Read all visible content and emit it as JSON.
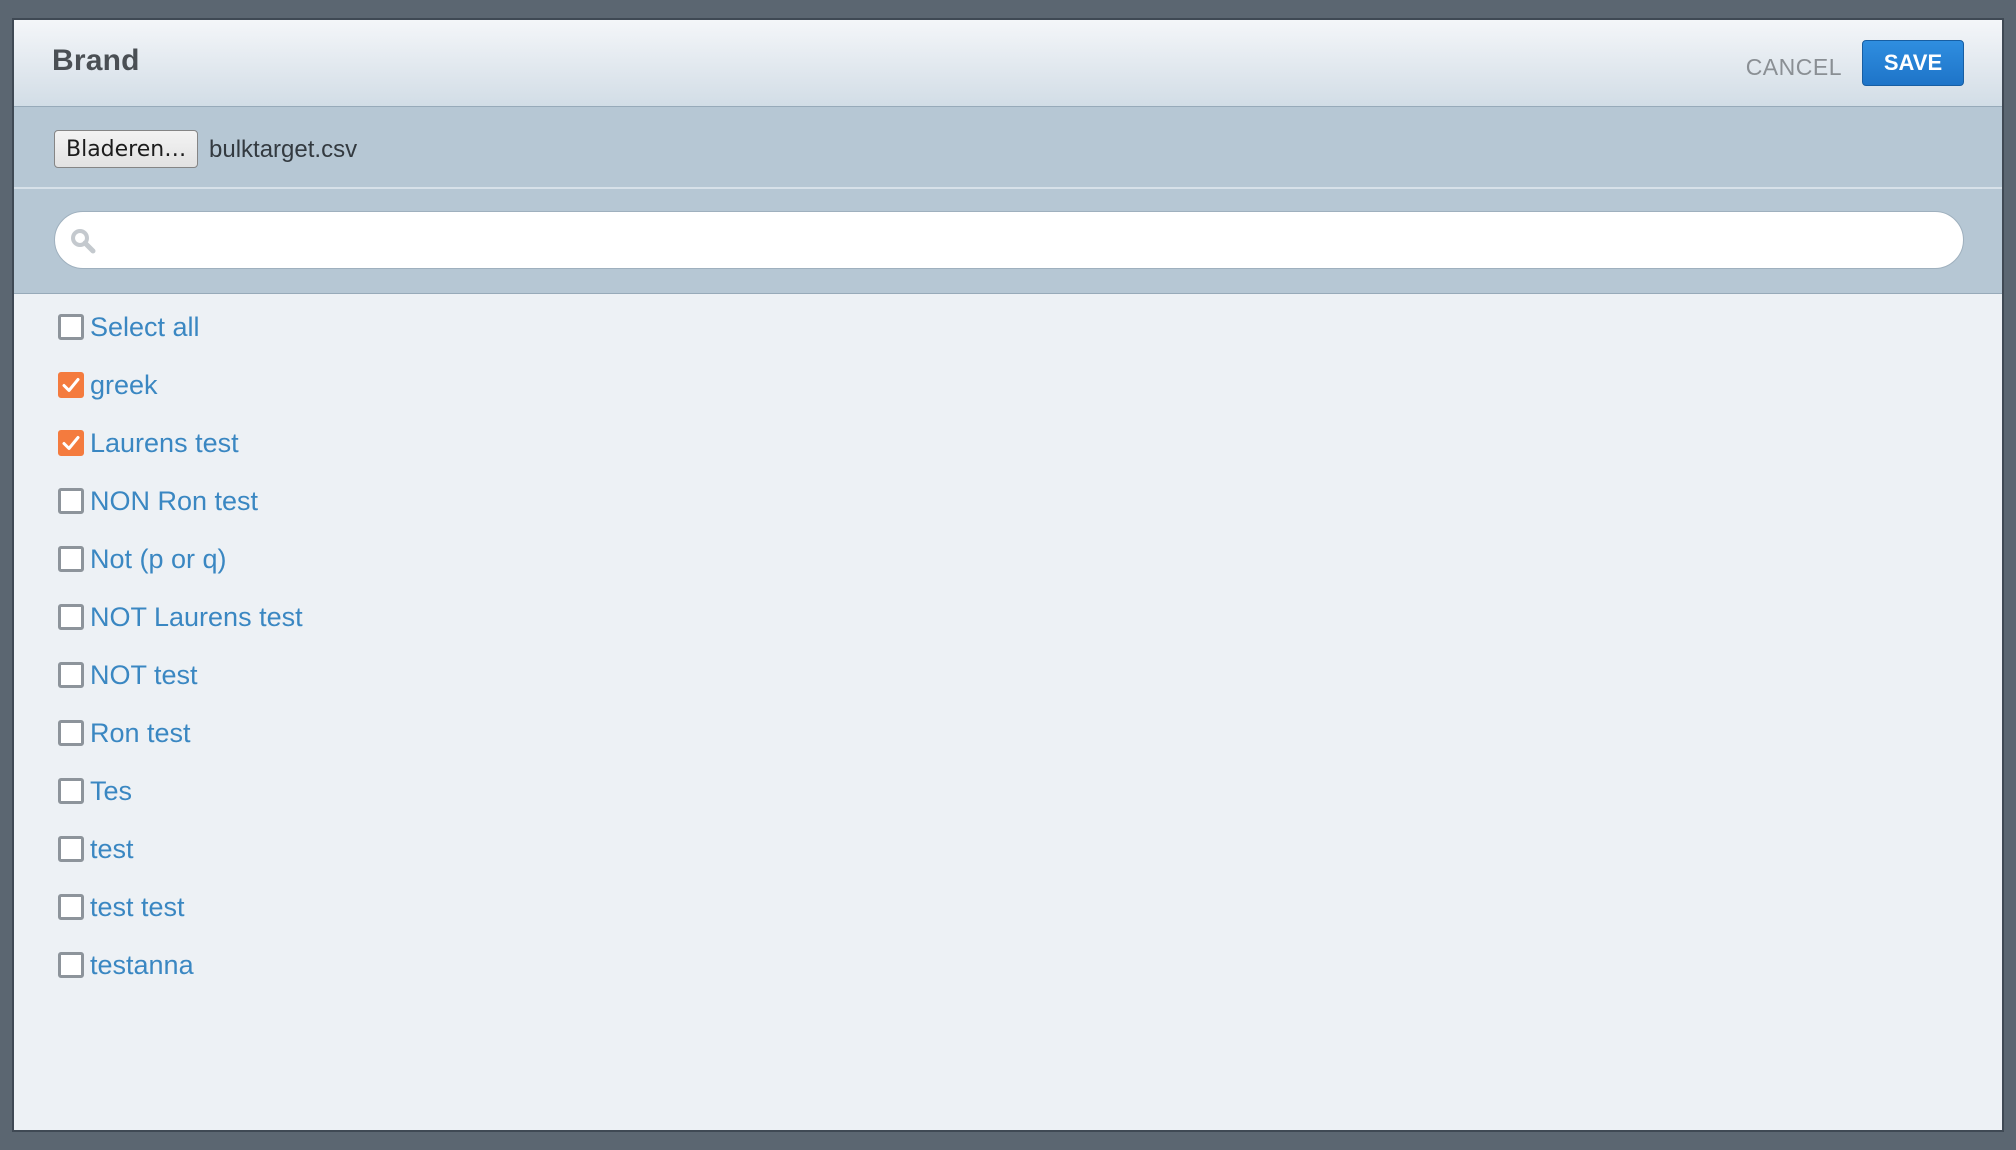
{
  "header": {
    "title": "Brand",
    "cancel_label": "CANCEL",
    "save_label": "SAVE"
  },
  "file": {
    "browse_label": "Bladeren…",
    "filename": "bulktarget.csv"
  },
  "search": {
    "value": "",
    "icon": "search-icon"
  },
  "colors": {
    "accent": "#1e74c8",
    "checked": "#f47b3e",
    "link": "#3a87c2"
  },
  "items": [
    {
      "label": "Select all",
      "checked": false
    },
    {
      "label": "greek",
      "checked": true
    },
    {
      "label": "Laurens test",
      "checked": true
    },
    {
      "label": "NON Ron test",
      "checked": false
    },
    {
      "label": "Not (p or q)",
      "checked": false
    },
    {
      "label": "NOT Laurens test",
      "checked": false
    },
    {
      "label": "NOT test",
      "checked": false
    },
    {
      "label": "Ron test",
      "checked": false
    },
    {
      "label": "Tes",
      "checked": false
    },
    {
      "label": "test",
      "checked": false
    },
    {
      "label": "test test",
      "checked": false
    },
    {
      "label": "testanna",
      "checked": false
    }
  ]
}
